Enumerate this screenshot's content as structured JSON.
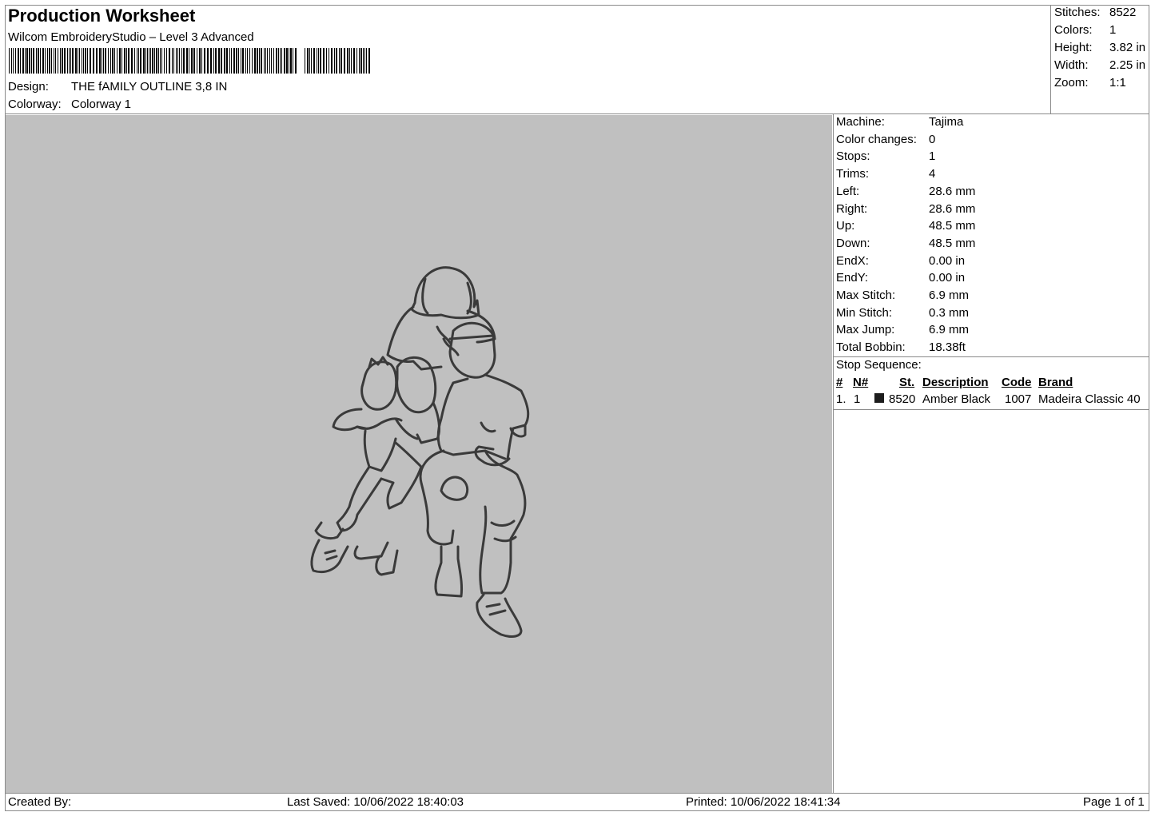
{
  "header": {
    "title": "Production Worksheet",
    "software": "Wilcom EmbroideryStudio – Level 3 Advanced",
    "design_label": "Design:",
    "design_value": "THE fAMILY OUTLINE 3,8 IN",
    "colorway_label": "Colorway:",
    "colorway_value": "Colorway 1"
  },
  "stats": [
    {
      "label": "Stitches:",
      "value": "8522"
    },
    {
      "label": "Colors:",
      "value": "1"
    },
    {
      "label": "Height:",
      "value": "3.82 in"
    },
    {
      "label": "Width:",
      "value": "2.25 in"
    },
    {
      "label": "Zoom:",
      "value": "1:1"
    }
  ],
  "machine_info": [
    {
      "label": "Machine:",
      "value": "Tajima"
    },
    {
      "label": "Color changes:",
      "value": "0"
    },
    {
      "label": "Stops:",
      "value": "1"
    },
    {
      "label": "Trims:",
      "value": "4"
    },
    {
      "label": "Left:",
      "value": "28.6 mm"
    },
    {
      "label": "Right:",
      "value": "28.6 mm"
    },
    {
      "label": "Up:",
      "value": "48.5 mm"
    },
    {
      "label": "Down:",
      "value": "48.5 mm"
    },
    {
      "label": "EndX:",
      "value": "0.00 in"
    },
    {
      "label": "EndY:",
      "value": "0.00 in"
    },
    {
      "label": "Max Stitch:",
      "value": "6.9 mm"
    },
    {
      "label": "Min Stitch:",
      "value": "0.3 mm"
    },
    {
      "label": "Max Jump:",
      "value": "6.9 mm"
    },
    {
      "label": "Total Bobbin:",
      "value": "18.38ft"
    }
  ],
  "stop_sequence": {
    "title": "Stop Sequence:",
    "headers": {
      "num": "#",
      "needle": "N#",
      "stitches": "St.",
      "description": "Description",
      "code": "Code",
      "brand": "Brand"
    },
    "rows": [
      {
        "num": "1.",
        "needle": "1",
        "swatch_color": "#1d1d1d",
        "stitches": "8520",
        "description": "Amber Black",
        "code": "1007",
        "brand": "Madeira Classic 40"
      }
    ]
  },
  "footer": {
    "created_by": "Created By:",
    "last_saved": "Last Saved: 10/06/2022 18:40:03",
    "printed": "Printed: 10/06/2022 18:41:34",
    "page": "Page 1 of 1"
  },
  "colors": {
    "preview_background": "#c0c0c0",
    "thread": "#3a3a3a"
  }
}
